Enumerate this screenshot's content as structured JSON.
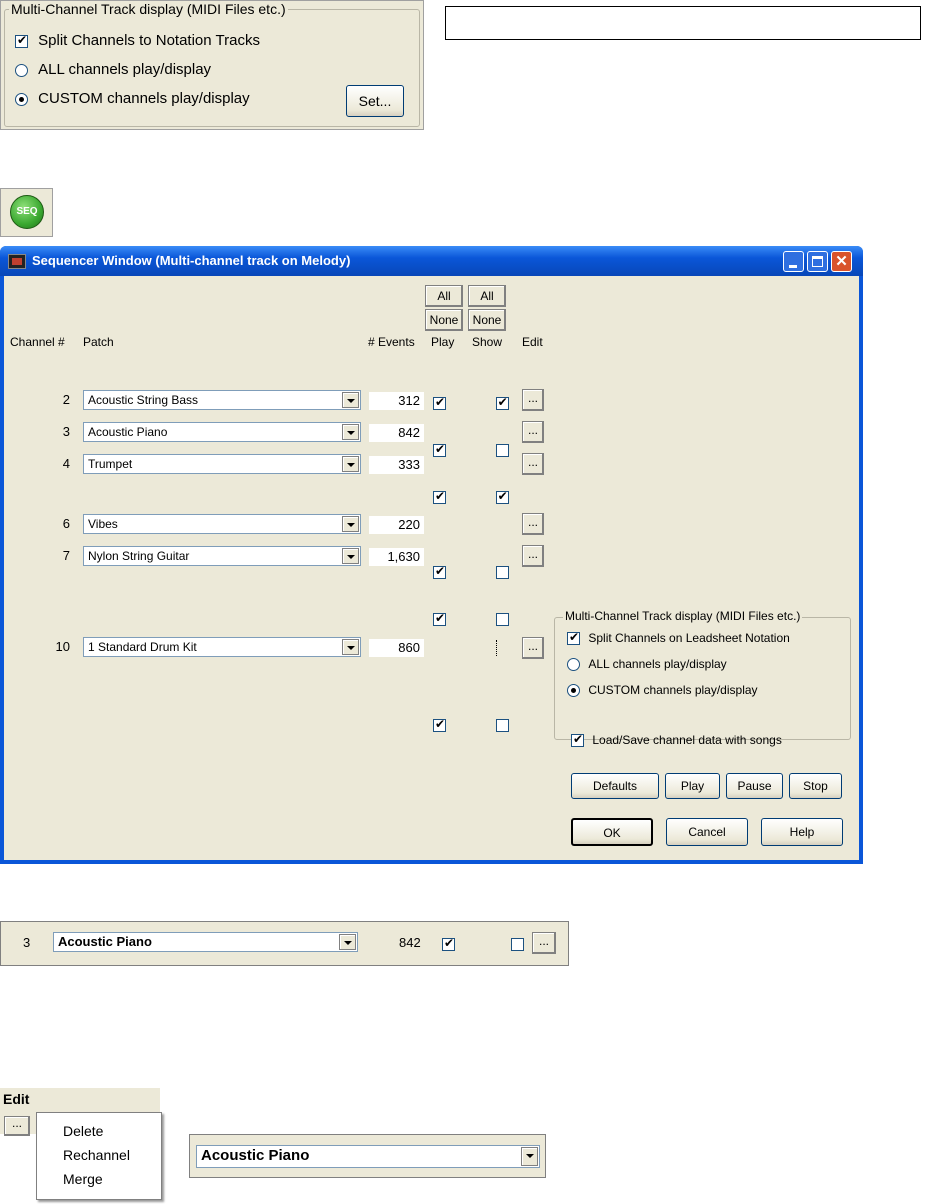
{
  "top_panel": {
    "title": "Multi-Channel Track display (MIDI Files etc.)",
    "split_label": "Split Channels to Notation Tracks",
    "all_label": "ALL channels play/display",
    "custom_label": "CUSTOM channels play/display",
    "set_button": "Set..."
  },
  "seq_icon_label": "SEQ",
  "window": {
    "title": "Sequencer Window  (Multi-channel track on Melody)",
    "headers": {
      "channel": "Channel #",
      "patch": "Patch",
      "events": "# Events",
      "play": "Play",
      "show": "Show",
      "edit": "Edit"
    },
    "all_label": "All",
    "none_label": "None",
    "rows": [
      {
        "channel": "2",
        "patch": "Acoustic String Bass",
        "events": "312",
        "play": true,
        "show": true
      },
      {
        "channel": "3",
        "patch": "Acoustic Piano",
        "events": "842",
        "play": true,
        "show": false
      },
      {
        "channel": "4",
        "patch": "Trumpet",
        "events": "333",
        "play": true,
        "show": true
      },
      {
        "channel": "6",
        "patch": "Vibes",
        "events": "220",
        "play": true,
        "show": false
      },
      {
        "channel": "7",
        "patch": "Nylon String Guitar",
        "events": "1,630",
        "play": true,
        "show": false
      },
      {
        "channel": "10",
        "patch": "1 Standard Drum Kit",
        "events": "860",
        "play": true,
        "show": false
      }
    ],
    "edit_button": "...",
    "group": {
      "title": "Multi-Channel Track display (MIDI Files etc.)",
      "split_label": "Split Channels on Leadsheet Notation",
      "all_label": "ALL channels play/display",
      "custom_label": "CUSTOM channels play/display"
    },
    "loadsave_label": "Load/Save channel data with songs",
    "buttons": {
      "defaults": "Defaults",
      "play": "Play",
      "pause": "Pause",
      "stop": "Stop",
      "ok": "OK",
      "cancel": "Cancel",
      "help": "Help"
    }
  },
  "row_detail": {
    "channel": "3",
    "patch": "Acoustic Piano",
    "events": "842",
    "edit": "..."
  },
  "edit_menu": {
    "header": "Edit",
    "button": "...",
    "items": [
      "Delete",
      "Rechannel",
      "Merge"
    ]
  },
  "combo_detail": {
    "value": "Acoustic Piano"
  },
  "colors": {
    "titlebar": "#0a56d8",
    "dialog_bg": "#ece9d8",
    "close_red": "#d9532b",
    "seq_green": "#3aa830"
  }
}
